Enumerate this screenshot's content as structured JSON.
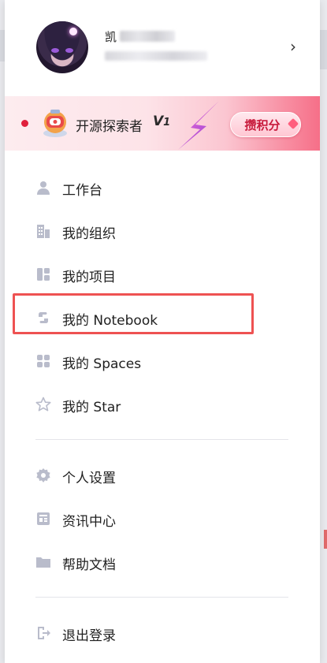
{
  "profile": {
    "name_visible_char": "凯",
    "chevron": "›"
  },
  "banner": {
    "title": "开源探索者",
    "level_mark": "V1",
    "earn_button": "攒积分",
    "accent": "#e0203c"
  },
  "menu": {
    "group1": [
      {
        "label": "工作台",
        "icon": "person-icon"
      },
      {
        "label": "我的组织",
        "icon": "building-icon"
      },
      {
        "label": "我的项目",
        "icon": "project-icon"
      },
      {
        "label": "我的 Notebook",
        "icon": "notebook-icon"
      },
      {
        "label": "我的 Spaces",
        "icon": "spaces-icon"
      },
      {
        "label": "我的 Star",
        "icon": "star-icon"
      }
    ],
    "group2": [
      {
        "label": "个人设置",
        "icon": "gear-icon"
      },
      {
        "label": "资讯中心",
        "icon": "news-icon"
      },
      {
        "label": "帮助文档",
        "icon": "folder-icon"
      }
    ],
    "group3": [
      {
        "label": "退出登录",
        "icon": "logout-icon"
      }
    ]
  },
  "highlight_color": "#ee5252",
  "icon_color": "#b9bccb"
}
